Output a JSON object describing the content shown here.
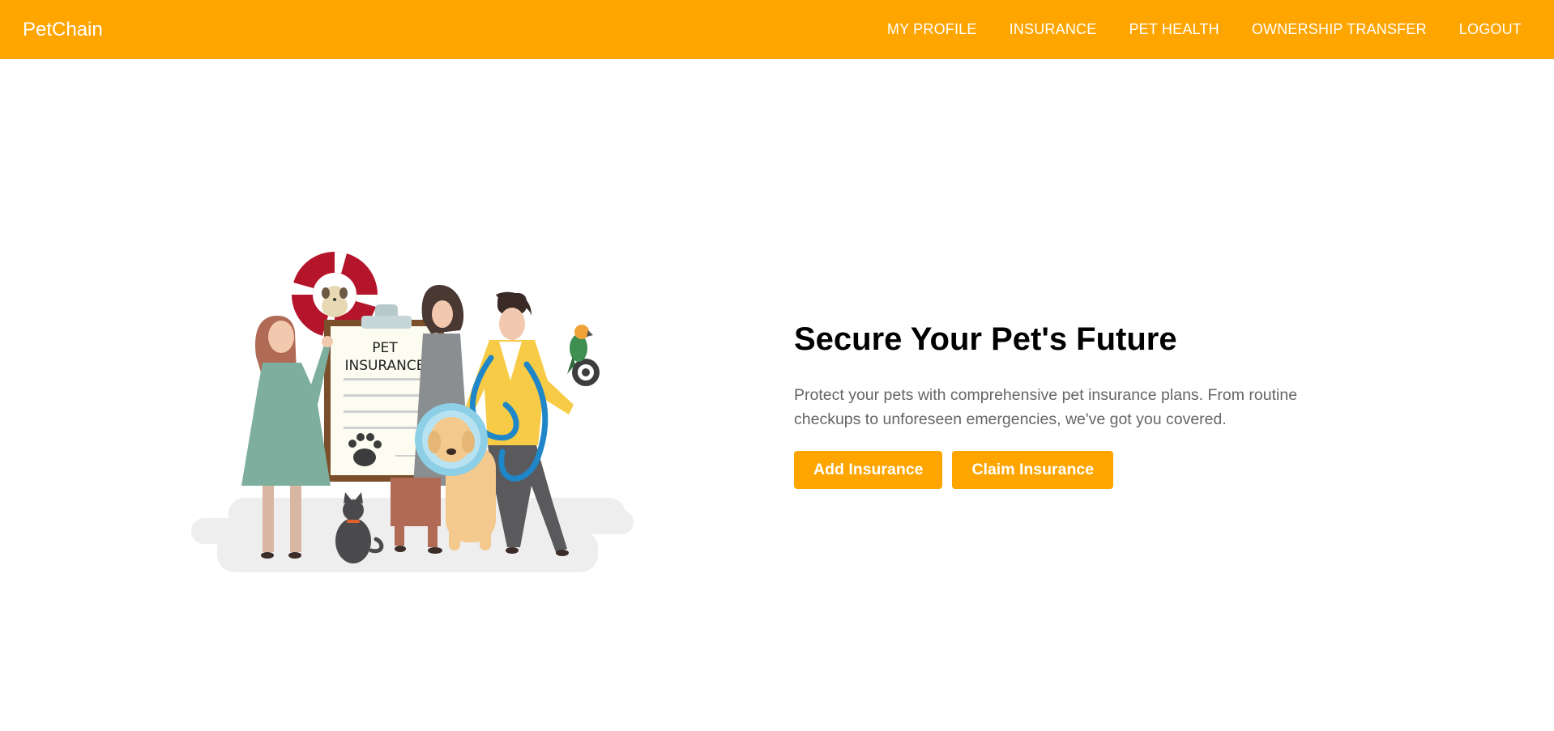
{
  "navbar": {
    "brand": "PetChain",
    "links": [
      {
        "label": "MY PROFILE"
      },
      {
        "label": "INSURANCE"
      },
      {
        "label": "PET HEALTH"
      },
      {
        "label": "OWNERSHIP TRANSFER"
      },
      {
        "label": "LOGOUT"
      }
    ],
    "color": "#ffa500"
  },
  "hero": {
    "illustration": {
      "clipboard_text_line1": "PET",
      "clipboard_text_line2": "INSURANCE"
    },
    "title": "Secure Your Pet's Future",
    "description": "Protect your pets with comprehensive pet insurance plans. From routine checkups to unforeseen emergencies, we've got you covered.",
    "buttons": {
      "add_label": "Add Insurance",
      "claim_label": "Claim Insurance"
    },
    "accent_color": "#ffa500"
  }
}
